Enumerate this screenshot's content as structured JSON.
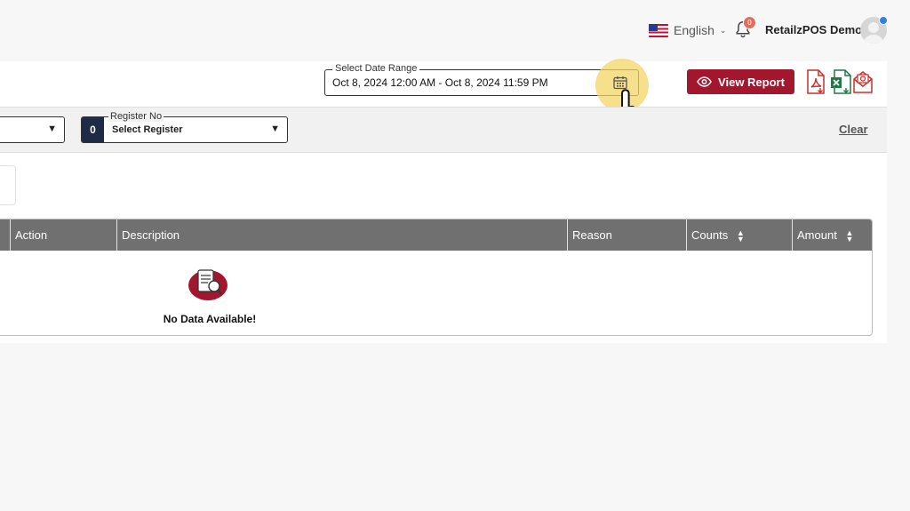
{
  "header": {
    "language": "English",
    "notification_count": "0",
    "user_name": "RetailzPOS Demo"
  },
  "date_range": {
    "label": "Select Date Range",
    "value": "Oct 8, 2024 12:00 AM - Oct 8, 2024 11:59 PM"
  },
  "actions": {
    "view_report": "View Report",
    "export_icons": [
      "pdf-icon",
      "excel-icon",
      "email-icon"
    ]
  },
  "filters": {
    "register": {
      "count": "0",
      "label": "Register No",
      "value": "Select Register"
    },
    "clear_label": "Clear"
  },
  "table": {
    "columns": [
      {
        "label": "Action",
        "sortable": false
      },
      {
        "label": "Description",
        "sortable": false
      },
      {
        "label": "Reason",
        "sortable": false
      },
      {
        "label": "Counts",
        "sortable": true
      },
      {
        "label": "Amount",
        "sortable": true
      }
    ],
    "empty_message": "No Data Available!"
  },
  "colors": {
    "brand": "#a3172e",
    "table_header": "#707070",
    "highlight": "#f4d666",
    "badge": "#1f2a44"
  }
}
